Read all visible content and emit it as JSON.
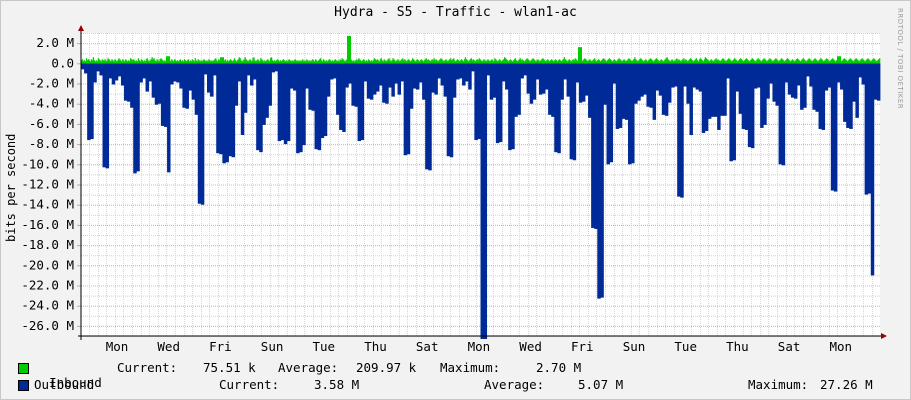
{
  "chart_data": {
    "type": "area",
    "title": "Hydra - S5 - Traffic - wlan1-ac",
    "ylabel": "bits per second",
    "yticks": [
      "2.0 M",
      "0.0",
      "-2.0 M",
      "-4.0 M",
      "-6.0 M",
      "-8.0 M",
      "-10.0 M",
      "-12.0 M",
      "-14.0 M",
      "-16.0 M",
      "-18.0 M",
      "-20.0 M",
      "-22.0 M",
      "-24.0 M",
      "-26.0 M"
    ],
    "ylim": [
      -27.0,
      3.0
    ],
    "x_labels": [
      "Mon",
      "Wed",
      "Fri",
      "Sun",
      "Tue",
      "Thu",
      "Sat",
      "Mon",
      "Wed",
      "Fri",
      "Sun",
      "Tue",
      "Thu",
      "Sat",
      "Mon"
    ],
    "grid": true,
    "series": [
      {
        "name": "Inbound",
        "color": "#00cc00",
        "values": [
          0.3,
          0.4,
          0.2,
          0.3,
          0.2,
          0.5,
          0.3,
          0.4,
          0.3,
          0.2,
          0.4,
          0.3,
          0.6,
          0.3,
          0.2,
          0.3,
          0.2,
          0.5,
          0.4,
          0.3,
          0.2,
          0.4,
          0.3,
          0.3,
          0.4,
          0.2,
          0.3,
          0.5,
          0.4,
          0.3,
          0.2,
          0.4,
          0.3,
          0.2,
          0.4,
          0.3,
          0.2,
          0.3,
          0.5,
          0.4,
          0.3,
          0.2,
          0.4,
          0.3,
          0.2,
          0.4,
          0.3,
          0.2,
          0.3,
          0.2,
          0.5,
          0.4,
          0.3,
          0.4,
          0.3,
          0.2,
          0.3,
          0.2,
          0.5,
          0.3,
          0.2,
          0.4,
          0.3,
          0.2,
          0.3,
          0.2,
          0.4,
          0.5,
          0.3,
          0.2,
          0.3,
          0.4,
          0.6,
          0.4,
          0.5,
          0.3,
          0.2,
          0.4,
          0.3,
          0.2,
          0.4,
          0.5,
          0.4,
          0.3,
          0.2,
          0.3,
          0.2,
          0.4,
          0.3,
          0.5,
          0.3,
          0.2,
          0.4,
          0.3,
          0.2,
          0.4,
          0.3,
          0.2,
          0.3,
          0.2,
          0.3,
          0.4,
          0.2,
          0.3,
          0.2,
          0.4,
          0.3,
          0.2,
          0.3,
          0.4,
          0.2,
          0.3,
          0.2,
          0.4,
          0.3,
          0.2,
          0.5,
          0.3,
          0.2,
          0.4,
          0.3,
          0.2,
          0.3,
          0.2,
          0.3,
          0.4,
          0.3,
          0.2,
          0.3,
          0.2,
          0.4,
          0.3,
          0.2,
          0.3,
          0.2,
          0.3,
          0.4,
          0.5,
          0.3,
          0.2,
          0.4,
          0.3,
          0.2,
          0.3,
          0.4,
          0.2,
          0.3,
          0.4,
          0.2,
          0.3,
          0.2,
          0.3,
          0.4,
          0.3,
          0.2,
          0.3,
          0.5,
          0.3,
          0.2,
          0.3,
          0.4,
          0.6,
          0.5,
          0.3,
          0.2,
          0.3,
          0.4,
          0.6,
          0.4,
          0.3,
          0.2,
          0.3,
          0.4,
          0.3,
          0.2,
          0.5,
          0.6,
          0.3,
          0.2,
          0.3,
          0.4,
          0.3,
          0.2,
          0.5,
          0.4,
          0.3,
          0.2,
          0.3,
          0.2,
          0.3,
          0.4,
          0.3,
          0.2,
          0.5,
          0.6,
          0.3,
          0.2,
          0.3,
          0.2,
          0.3,
          0.4,
          0.3,
          0.2,
          0.3,
          0.2,
          0.3,
          0.4,
          0.3,
          0.2,
          0.3,
          0.2,
          0.3,
          0.4,
          0.3,
          0.2,
          0.3,
          0.2,
          0.3,
          0.4,
          0.3,
          0.2,
          0.3,
          0.2,
          0.3,
          0.2,
          0.3,
          0.4,
          0.2,
          0.3,
          0.2,
          0.4,
          0.3,
          0.2,
          0.3,
          0.2,
          0.3,
          0.4,
          0.3,
          0.2,
          0.4,
          0.3,
          0.2,
          0.3,
          0.4,
          0.5,
          0.3,
          0.2,
          0.4,
          0.3,
          0.2,
          0.3,
          0.2,
          0.3,
          0.4,
          0.3,
          0.2,
          0.3,
          0.2,
          0.3,
          0.4,
          0.3,
          0.2,
          0.3,
          0.2,
          0.4,
          0.3,
          0.5,
          0.4,
          0.3,
          0.2,
          0.3,
          0.4,
          0.3,
          0.2,
          0.3,
          0.4,
          0.3,
          0.2,
          0.3,
          0.2,
          0.3,
          0.4,
          0.3,
          0.5,
          0.4,
          0.3,
          0.2,
          0.3,
          0.4,
          0.3,
          0.2,
          0.3,
          0.2,
          0.4,
          0.3,
          0.2,
          0.3,
          0.2,
          0.3,
          0.5,
          0.4,
          0.3,
          0.4,
          0.3,
          0.2,
          0.4,
          0.5,
          0.3,
          0.2,
          0.4,
          0.3,
          0.2,
          0.3,
          0.4,
          0.5,
          0.3,
          0.2,
          0.3,
          0.5,
          0.4,
          0.3,
          0.2,
          0.3,
          0.4,
          0.3,
          0.2,
          0.3,
          0.4,
          0.5,
          0.3,
          0.4,
          0.3,
          0.2,
          0.3,
          0.4,
          0.3,
          0.2,
          0.3,
          0.5,
          0.4,
          0.3,
          0.2,
          0.3,
          0.4,
          0.3,
          0.2,
          0.3,
          0.4,
          0.3,
          0.2,
          0.3,
          0.4,
          0.5,
          0.3,
          0.4,
          0.3,
          0.2,
          0.3,
          0.4,
          0.3,
          0.5,
          0.3,
          0.4,
          0.3,
          0.2,
          0.3,
          0.4,
          0.5,
          0.4,
          0.3,
          0.2,
          0.3,
          0.4,
          0.3,
          0.2,
          0.3,
          0.4,
          0.5,
          0.3,
          0.4,
          0.5,
          0.3,
          0.2,
          0.3,
          0.4,
          0.3,
          0.2,
          0.3,
          0.4,
          0.3,
          0.2,
          0.4,
          0.6,
          0.4,
          0.3,
          0.2,
          0.3,
          0.4,
          0.5,
          0.3,
          0.4,
          0.3,
          0.2,
          0.3,
          0.4,
          0.3,
          0.5,
          0.4,
          0.3,
          0.2,
          0.3,
          0.4,
          0.3,
          0.2,
          0.3,
          0.4,
          0.3,
          0.2,
          0.3,
          0.4,
          0.3,
          0.2,
          0.5,
          0.4,
          0.3,
          0.2,
          0.3,
          0.4,
          0.3,
          0.2,
          0.3,
          0.4,
          0.6,
          0.5,
          0.4,
          0.3,
          0.2,
          0.3,
          0.4,
          0.3,
          0.2,
          0.3,
          0.4,
          0.5,
          0.3,
          0.2,
          0.3,
          0.4,
          0.5,
          0.3,
          0.4,
          0.3,
          0.2,
          0.3,
          0.4,
          0.5,
          0.4,
          0.3,
          0.2,
          0.3,
          0.4,
          0.5,
          0.4,
          0.3,
          0.2,
          0.3,
          0.4,
          0.3,
          0.2,
          0.3,
          0.4,
          0.5,
          0.4,
          0.3,
          0.2,
          0.3,
          0.4,
          0.3,
          0.2,
          0.3,
          0.4,
          0.3,
          0.2,
          0.3,
          0.4,
          0.3,
          0.2,
          0.3,
          0.4,
          0.3,
          0.2,
          0.3,
          0.4,
          0.6,
          0.4,
          0.3,
          0.2,
          0.3,
          0.4,
          0.3,
          0.2,
          0.3,
          0.4,
          0.3,
          0.5,
          0.4,
          0.3,
          0.2,
          0.3,
          0.4,
          0.3,
          0.2,
          0.3,
          0.4,
          0.5,
          0.4,
          0.3,
          0.2,
          0.3,
          0.4,
          0.3,
          0.2,
          0.3,
          0.4,
          0.5,
          0.3,
          0.2,
          0.3,
          0.4,
          0.3,
          0.2,
          0.3,
          0.4,
          0.5,
          0.4,
          0.3,
          0.2,
          0.3,
          0.4,
          0.5,
          0.4,
          0.3,
          0.2,
          0.3,
          0.4,
          0.3,
          0.2,
          0.3,
          0.4,
          0.5,
          0.4,
          0.3,
          0.2,
          0.3,
          0.4,
          0.3,
          0.2,
          0.3,
          0.4,
          0.5,
          0.4,
          0.3,
          0.2,
          0.3,
          0.4,
          0.6,
          0.4,
          0.3,
          0.2,
          0.3,
          0.4,
          0.5,
          0.4,
          0.3,
          0.2,
          0.3,
          0.4,
          0.3,
          0.2,
          0.3,
          0.4,
          0.5,
          0.4,
          0.3,
          0.2,
          0.3,
          0.4,
          0.5,
          0.4,
          0.3,
          0.2,
          0.3,
          0.4,
          0.3,
          0.2,
          0.3,
          0.4,
          0.5,
          0.6,
          0.4,
          0.3,
          0.2,
          0.3,
          0.4,
          0.3,
          0.2,
          0.3,
          0.4,
          0.5,
          0.3,
          0.4,
          0.3,
          0.2,
          0.3,
          0.4,
          0.5,
          0.3,
          0.4,
          0.3,
          0.2,
          0.3,
          0.4,
          0.5,
          0.4,
          0.3,
          0.2,
          0.3,
          0.4,
          0.5,
          0.3,
          0.2,
          0.4,
          0.5,
          0.4,
          0.3,
          0.2,
          0.4,
          0.6,
          0.5,
          0.4,
          0.3,
          0.2,
          0.3,
          0.4,
          0.3,
          0.2,
          0.3,
          0.4,
          0.5,
          0.3,
          0.4,
          0.3,
          0.2,
          0.3,
          0.4,
          0.5,
          0.4,
          0.3,
          0.2,
          0.3,
          0.4,
          0.5,
          0.4,
          0.3,
          0.2,
          0.3,
          0.4,
          0.5,
          0.4,
          0.3,
          0.2,
          0.3,
          0.4,
          0.5,
          0.4,
          0.3,
          0.2,
          0.3,
          0.4,
          0.5,
          0.4,
          0.3,
          0.2,
          0.3,
          0.4,
          0.5,
          0.4,
          0.3,
          0.2,
          0.3,
          0.4,
          0.5,
          0.4,
          0.3,
          0.2,
          0.3,
          0.4,
          0.5,
          0.4,
          0.3,
          0.2,
          0.3,
          0.4,
          0.5,
          0.4,
          0.3,
          0.2,
          0.3,
          0.4,
          0.5,
          0.4,
          0.3,
          0.2,
          0.3,
          0.4,
          0.5,
          0.4,
          0.3,
          0.2,
          0.3,
          0.4,
          0.5,
          0.4,
          0.3,
          0.2,
          0.3,
          0.4,
          0.3,
          0.2,
          0.3,
          0.4,
          0.5,
          0.4,
          0.3,
          0.2,
          0.3,
          0.4,
          0.5,
          0.4,
          0.3,
          0.2,
          0.3,
          0.4,
          0.5,
          0.4,
          0.3,
          0.2,
          0.3,
          0.4,
          0.5,
          0.4,
          0.3,
          0.2,
          0.3,
          0.4,
          0.5,
          0.4,
          0.3,
          0.2,
          0.3,
          0.4,
          0.5,
          0.4,
          0.3,
          0.2,
          0.3,
          0.4,
          0.5,
          0.4,
          0.3,
          0.2,
          0.3,
          0.4,
          0.5,
          0.4,
          0.3,
          0.2,
          0.3,
          0.4,
          0.5,
          0.4,
          0.3,
          0.2,
          0.3,
          0.4,
          0.5,
          0.4,
          0.3,
          0.2,
          0.3,
          0.4,
          0.5,
          0.4,
          0.3,
          0.2,
          0.3,
          0.4,
          0.5,
          0.4,
          0.3,
          0.2,
          0.3,
          0.4,
          0.5,
          0.4,
          0.3,
          0.2,
          0.3,
          0.4,
          0.5,
          0.4,
          0.3,
          0.2,
          0.3,
          0.4,
          0.5
        ]
      },
      {
        "name": "Outbound",
        "color": "#002a97",
        "values": [
          -0.6,
          -1.0,
          -7.6,
          -7.5,
          -1.9,
          -0.8,
          -1.2,
          -10.3,
          -10.4,
          -1.5,
          -2.1,
          -1.7,
          -1.3,
          -2.2,
          -3.7,
          -3.8,
          -4.4,
          -10.9,
          -10.7,
          -1.9,
          -1.5,
          -2.8,
          -1.8,
          -3.4,
          -4.1,
          -4.0,
          -6.2,
          -6.3,
          -10.8,
          -2.1,
          -1.8,
          -1.9,
          -2.5,
          -4.4,
          -4.5,
          -2.7,
          -3.6,
          -5.1,
          -13.9,
          -14.0,
          -1.1,
          -2.9,
          -3.3,
          -1.2,
          -8.9,
          -9.0,
          -9.9,
          -9.8,
          -9.2,
          -9.3,
          -4.2,
          -1.8,
          -7.1,
          -4.9,
          -1.2,
          -2.2,
          -1.6,
          -8.6,
          -8.8,
          -6.1,
          -5.4,
          -4.2,
          -0.9,
          -0.8,
          -7.7,
          -7.6,
          -8.0,
          -7.7,
          -2.5,
          -2.7,
          -8.9,
          -8.8,
          -8.1,
          -2.5,
          -4.6,
          -4.7,
          -8.5,
          -8.6,
          -7.4,
          -7.2,
          -3.3,
          -1.6,
          -1.5,
          -5.1,
          -6.6,
          -6.8,
          -2.4,
          -2.0,
          -4.2,
          -4.3,
          -7.7,
          -7.6,
          -1.8,
          -3.5,
          -3.6,
          -3.1,
          -2.8,
          -2.2,
          -3.9,
          -4.0,
          -2.4,
          -3.3,
          -2.0,
          -3.1,
          -1.8,
          -9.1,
          -9.0,
          -4.5,
          -2.5,
          -2.6,
          -1.9,
          -3.6,
          -10.5,
          -10.6,
          -2.9,
          -3.1,
          -1.5,
          -2.2,
          -3.3,
          -9.2,
          -9.3,
          -3.4,
          -1.6,
          -1.5,
          -2.2,
          -1.8,
          -2.6,
          -0.8,
          -7.6,
          -7.5,
          -27.5,
          -28.0,
          -1.2,
          -3.6,
          -3.4,
          -7.9,
          -7.8,
          -1.8,
          -2.6,
          -8.6,
          -8.5,
          -5.3,
          -5.1,
          -1.5,
          -1.2,
          -3.0,
          -4.0,
          -3.6,
          -1.6,
          -3.1,
          -3.0,
          -2.6,
          -5.1,
          -5.3,
          -8.8,
          -8.9,
          -3.6,
          -1.6,
          -3.3,
          -9.5,
          -9.6,
          -1.9,
          -3.9,
          -3.8,
          -3.2,
          -5.4,
          -16.3,
          -16.4,
          -23.3,
          -23.2,
          -4.1,
          -10.0,
          -9.8,
          -2.0,
          -6.5,
          -6.4,
          -5.5,
          -5.6,
          -10.0,
          -9.9,
          -4.0,
          -3.7,
          -3.3,
          -3.1,
          -4.3,
          -4.4,
          -5.6,
          -2.7,
          -3.2,
          -5.1,
          -5.2,
          -3.9,
          -2.4,
          -2.3,
          -13.2,
          -13.3,
          -2.3,
          -4.0,
          -7.1,
          -2.4,
          -2.6,
          -2.8,
          -6.9,
          -6.7,
          -5.5,
          -5.3,
          -5.3,
          -6.6,
          -5.2,
          -5.2,
          -1.5,
          -9.7,
          -9.6,
          -2.8,
          -5.0,
          -6.5,
          -6.6,
          -8.3,
          -8.4,
          -2.5,
          -2.4,
          -6.4,
          -6.1,
          -3.5,
          -2.0,
          -3.8,
          -4.2,
          -10.0,
          -10.1,
          -1.9,
          -3.1,
          -3.4,
          -3.5,
          -2.2,
          -4.6,
          -4.4,
          -1.3,
          -2.3,
          -4.6,
          -4.8,
          -6.5,
          -6.6,
          -2.7,
          -2.4,
          -12.6,
          -12.7,
          -1.9,
          -2.6,
          -5.8,
          -6.4,
          -6.5,
          -3.8,
          -5.4,
          -1.4,
          -2.1,
          -13.0,
          -12.9,
          -21.0,
          -3.6,
          -3.7
        ]
      }
    ]
  },
  "legend": {
    "inbound": {
      "label": "Inbound",
      "current_label": "Current:",
      "current_value": "75.51 k",
      "average_label": "Average:",
      "average_value": "209.97 k",
      "maximum_label": "Maximum:",
      "maximum_value": "2.70 M",
      "color": "#00cc00"
    },
    "outbound": {
      "label": "Outbound",
      "current_label": "Current:",
      "current_value": "3.58 M",
      "average_label": "Average:",
      "average_value": "5.07 M",
      "maximum_label": "Maximum:",
      "maximum_value": "27.26 M",
      "color": "#002a97"
    }
  },
  "watermark": "RRDTOOL / TOBI OETIKER"
}
